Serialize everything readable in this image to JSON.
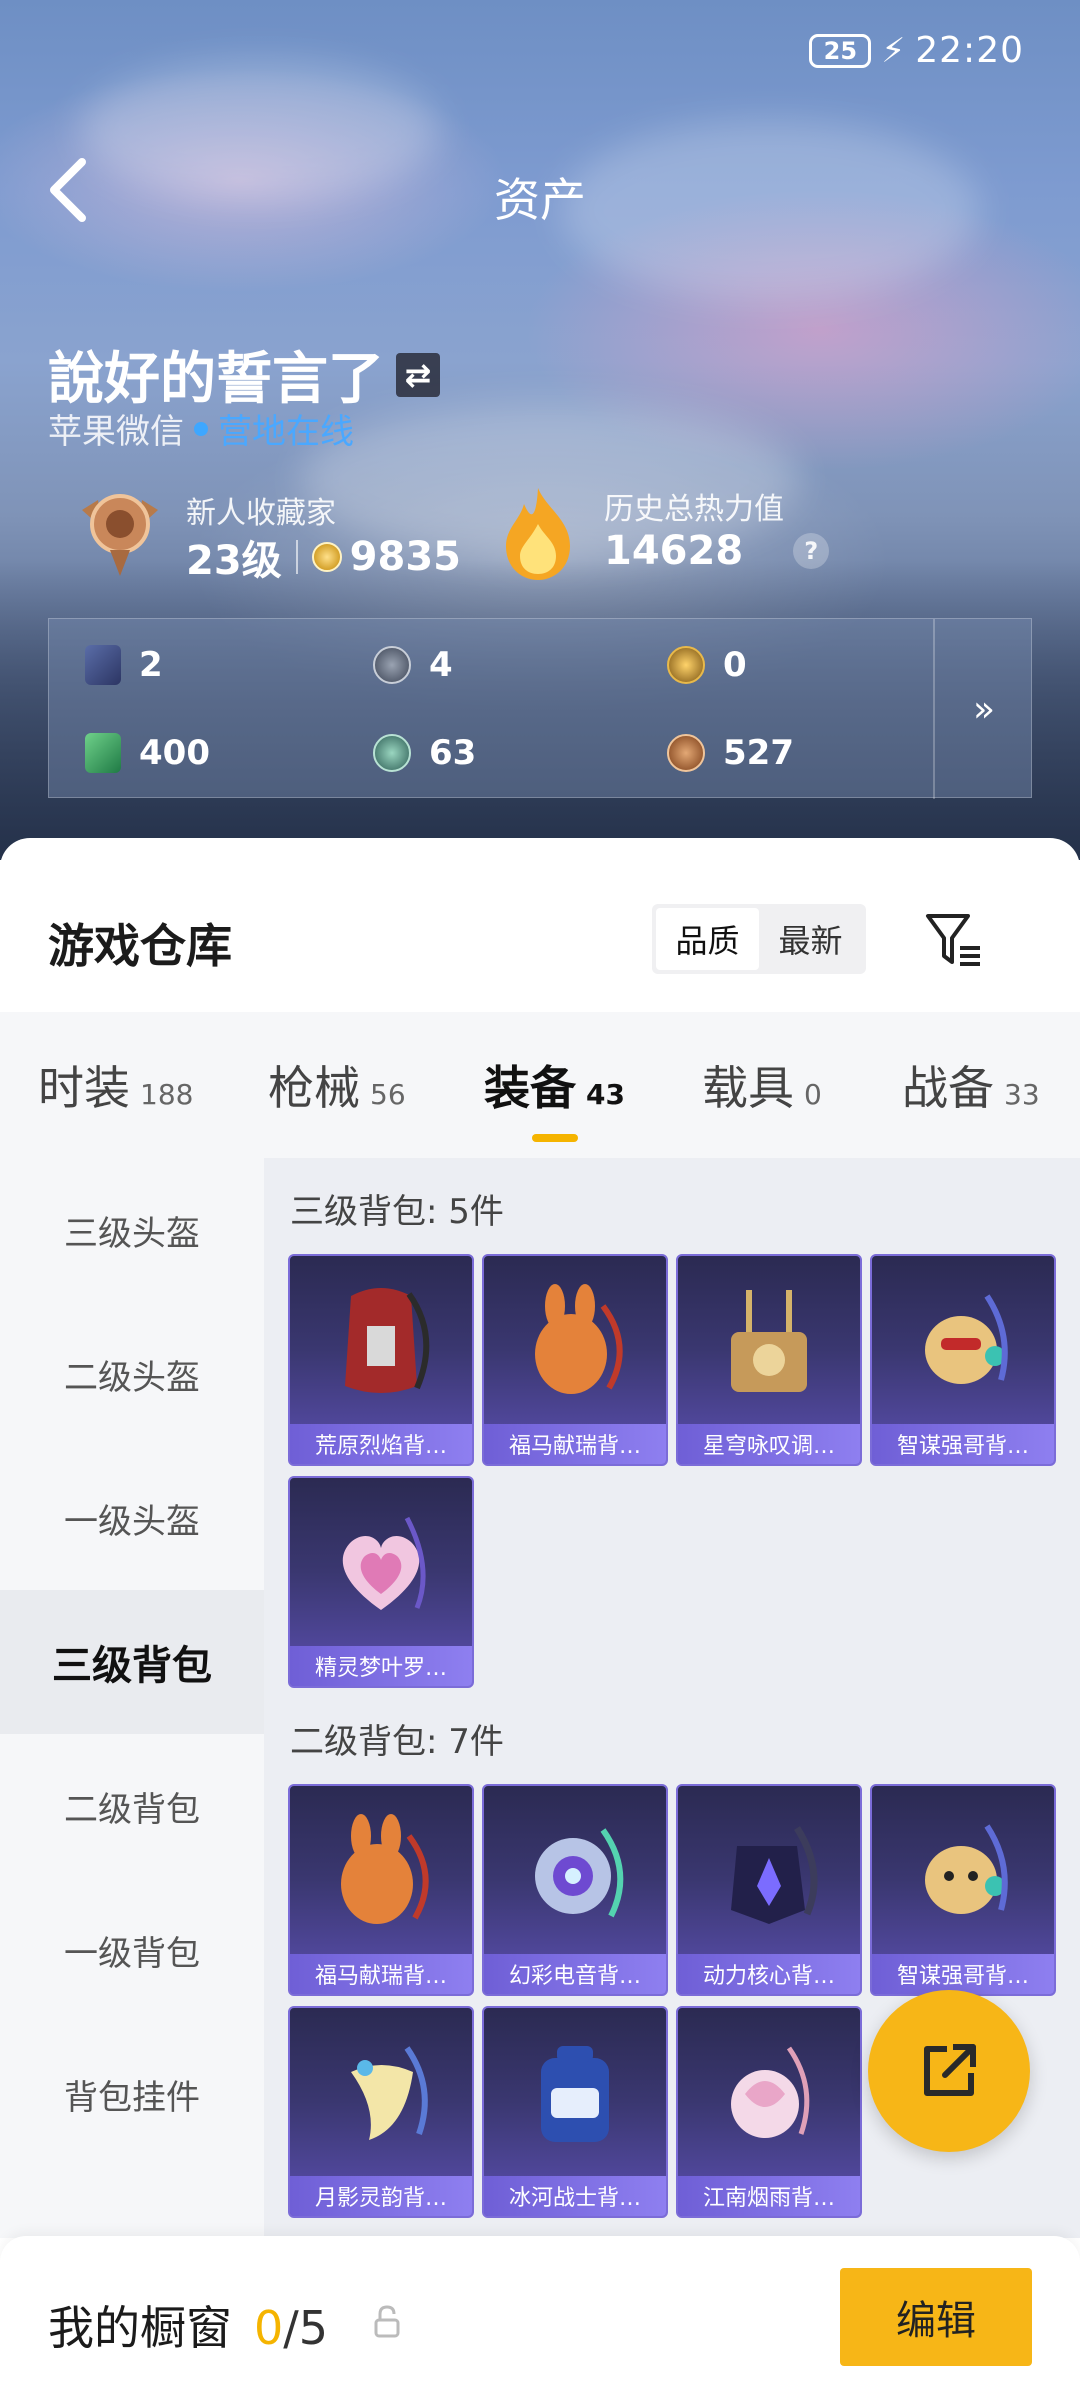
{
  "status_bar": {
    "battery": "25",
    "time": "22:20"
  },
  "header": {
    "title": "资产"
  },
  "profile": {
    "username": "說好的誓言了",
    "platform": "苹果微信",
    "online_status": "营地在线",
    "rank_title": "新人收藏家",
    "level": "23级",
    "coins": "9835",
    "heat_label": "历史总热力值",
    "heat_value": "14628"
  },
  "currencies": [
    {
      "icon": "card-icon",
      "value": "2"
    },
    {
      "icon": "s-coin-icon",
      "value": "4"
    },
    {
      "icon": "gold-badge-icon",
      "value": "0"
    },
    {
      "icon": "ticket-icon",
      "value": "400"
    },
    {
      "icon": "green-orb-icon",
      "value": "63"
    },
    {
      "icon": "bronze-coin-icon",
      "value": "527"
    }
  ],
  "warehouse": {
    "title": "游戏仓库",
    "sort_options": [
      "品质",
      "最新"
    ],
    "active_sort": "品质",
    "tabs": [
      {
        "label": "时装",
        "count": "188"
      },
      {
        "label": "枪械",
        "count": "56"
      },
      {
        "label": "装备",
        "count": "43"
      },
      {
        "label": "载具",
        "count": "0"
      },
      {
        "label": "战备",
        "count": "33"
      }
    ],
    "active_tab": "装备",
    "side_nav": [
      "三级头盔",
      "二级头盔",
      "一级头盔",
      "三级背包",
      "二级背包",
      "一级背包",
      "背包挂件"
    ],
    "active_side": "三级背包",
    "groups": [
      {
        "title": "三级背包: 5件",
        "items": [
          "荒原烈焰背…",
          "福马献瑞背…",
          "星穹咏叹调…",
          "智谋强哥背…",
          "精灵梦叶罗…"
        ]
      },
      {
        "title": "二级背包: 7件",
        "items": [
          "福马献瑞背…",
          "幻彩电音背…",
          "动力核心背…",
          "智谋强哥背…",
          "月影灵韵背…",
          "冰河战士背…",
          "江南烟雨背…"
        ]
      }
    ]
  },
  "showcase": {
    "label": "我的橱窗",
    "current": "0",
    "total": "/5",
    "edit_label": "编辑"
  },
  "colors": {
    "accent": "#f7b617",
    "card_bg": "#3a3770",
    "card_label": "#7b6cd8",
    "online": "#4aa8ff"
  }
}
